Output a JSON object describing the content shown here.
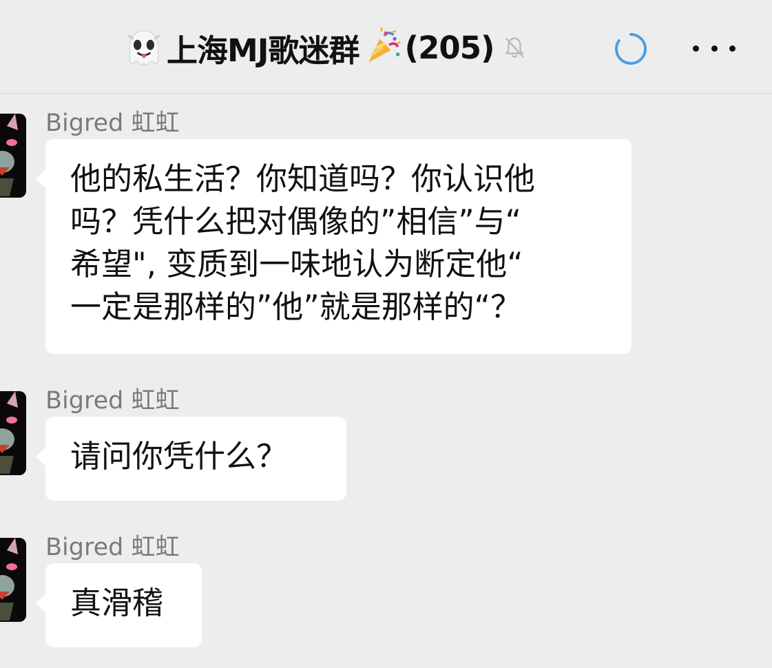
{
  "header": {
    "title": "上海MJ歌迷群",
    "member_count": "(205)",
    "left_emoji": "ghost-with-tongue-icon",
    "right_emoji": "party-popper-icon",
    "muted_icon": "bell-slash-icon",
    "loading_icon": "loading-spinner-icon",
    "more_icon": "more-horizontal-icon"
  },
  "messages": [
    {
      "sender": "Bigred 虹虹",
      "lines": [
        "他的私生活？你知道吗？你认识他",
        "吗？凭什么把对偶像的”相信”与“",
        "希望\", 变质到一味地认为断定他“",
        "一定是那样的”他”就是那样的“？"
      ]
    },
    {
      "sender": "Bigred 虹虹",
      "lines": [
        "请问你凭什么？"
      ]
    },
    {
      "sender": "Bigred 虹虹",
      "lines": [
        "真滑稽"
      ]
    }
  ]
}
